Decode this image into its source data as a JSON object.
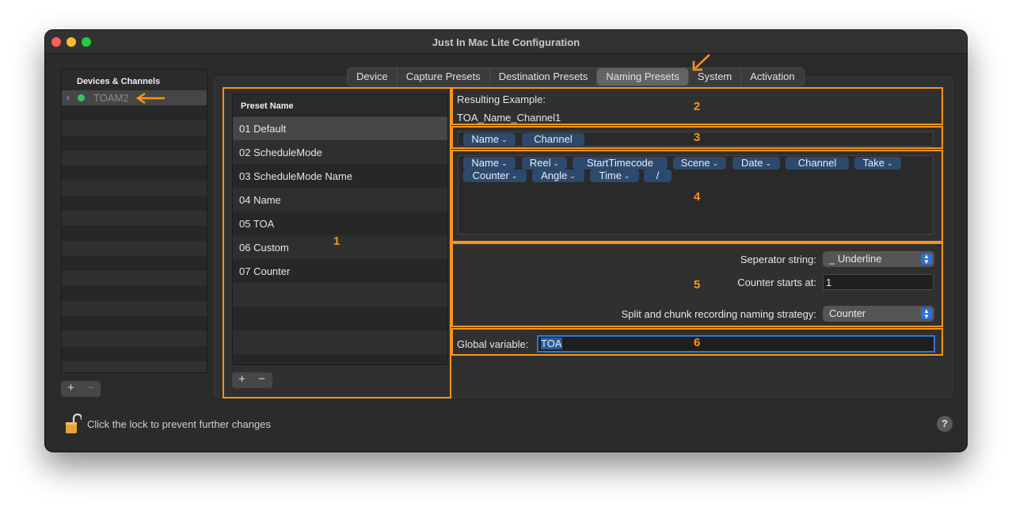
{
  "window": {
    "title": "Just In Mac Lite Configuration"
  },
  "devices": {
    "header": "Devices & Channels",
    "items": [
      {
        "label": "TOAM2",
        "status": "online"
      }
    ],
    "add_label": "+",
    "remove_label": "−"
  },
  "tabs": [
    {
      "label": "Device"
    },
    {
      "label": "Capture Presets"
    },
    {
      "label": "Destination Presets"
    },
    {
      "label": "Naming Presets",
      "active": true
    },
    {
      "label": "System"
    },
    {
      "label": "Activation"
    }
  ],
  "presets": {
    "header": "Preset Name",
    "items": [
      {
        "label": "01 Default"
      },
      {
        "label": "02 ScheduleMode"
      },
      {
        "label": "03 ScheduleMode Name"
      },
      {
        "label": "04 Name"
      },
      {
        "label": "05 TOA"
      },
      {
        "label": "06 Custom"
      },
      {
        "label": "07 Counter"
      }
    ],
    "add_label": "+",
    "remove_label": "−"
  },
  "example": {
    "label": "Resulting Example:",
    "value": "TOA_Name_Channel1"
  },
  "selected_tokens": [
    {
      "label": "Name",
      "dropdown": true
    },
    {
      "label": "Channel",
      "dropdown": false
    }
  ],
  "available_tokens": [
    {
      "label": "Name",
      "dropdown": true
    },
    {
      "label": "Reel",
      "dropdown": true
    },
    {
      "label": "StartTimecode",
      "dropdown": false
    },
    {
      "label": "Scene",
      "dropdown": true
    },
    {
      "label": "Date",
      "dropdown": true
    },
    {
      "label": "Channel",
      "dropdown": false
    },
    {
      "label": "Take",
      "dropdown": true
    },
    {
      "label": "Counter",
      "dropdown": true
    },
    {
      "label": "Angle",
      "dropdown": true
    },
    {
      "label": "Time",
      "dropdown": true
    },
    {
      "label": "/",
      "dropdown": false
    }
  ],
  "settings": {
    "separator_label": "Seperator string:",
    "separator_value": "_ Underline",
    "counter_label": "Counter starts at:",
    "counter_value": "1",
    "split_label": "Split and chunk recording naming strategy:",
    "split_value": "Counter"
  },
  "global": {
    "label": "Global variable:",
    "value": "TOA"
  },
  "footer": {
    "lock_text": "Click the lock to prevent further changes",
    "help_label": "?"
  },
  "annotations": [
    "1",
    "2",
    "3",
    "4",
    "5",
    "6"
  ],
  "colors": {
    "annotation": "#f7941d",
    "token": "#2d4a6e",
    "accent": "#2f6fd8"
  }
}
